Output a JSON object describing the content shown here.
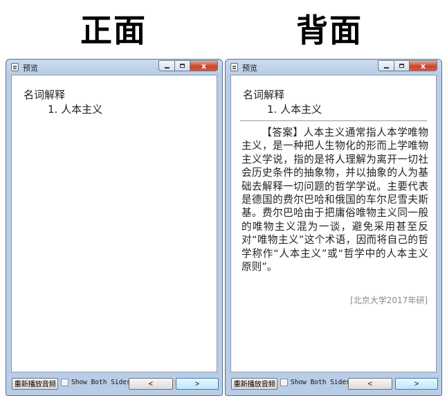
{
  "headings": {
    "front": "正面",
    "back": "背面"
  },
  "window": {
    "title": "预览",
    "close_glyph": "x"
  },
  "card": {
    "question_title": "名词解释",
    "question_item": "1. 人本主义",
    "answer": "【答案】人本主义通常指人本学唯物主义，是一种把人生物化的形而上学唯物主义学说，指的是将人理解为离开一切社会历史条件的抽象物，并以抽象的人为基础去解释一切问题的哲学学说。主要代表是德国的费尔巴哈和俄国的车尔尼雪夫斯基。费尔巴哈由于把庸俗唯物主义同一般的唯物主义混为一谈，避免采用甚至反对“唯物主义”这个术语，因而将自己的哲学称作“人本主义”或“哲学中的人本主义原则”。",
    "source": "[北京大学2017年研]"
  },
  "controls": {
    "replay_label": "重新播放音频",
    "show_both_label": "Show Both Sides",
    "show_both_checked": false,
    "prev_label": "<",
    "next_label": ">"
  },
  "colors": {
    "titlebar": "#b9cde6",
    "close_button": "#c9452c",
    "next_button_border": "#3c7fb1"
  },
  "icons": {
    "app": "preview-app-icon",
    "minimize": "minimize-icon",
    "maximize": "maximize-icon",
    "close": "close-icon"
  }
}
